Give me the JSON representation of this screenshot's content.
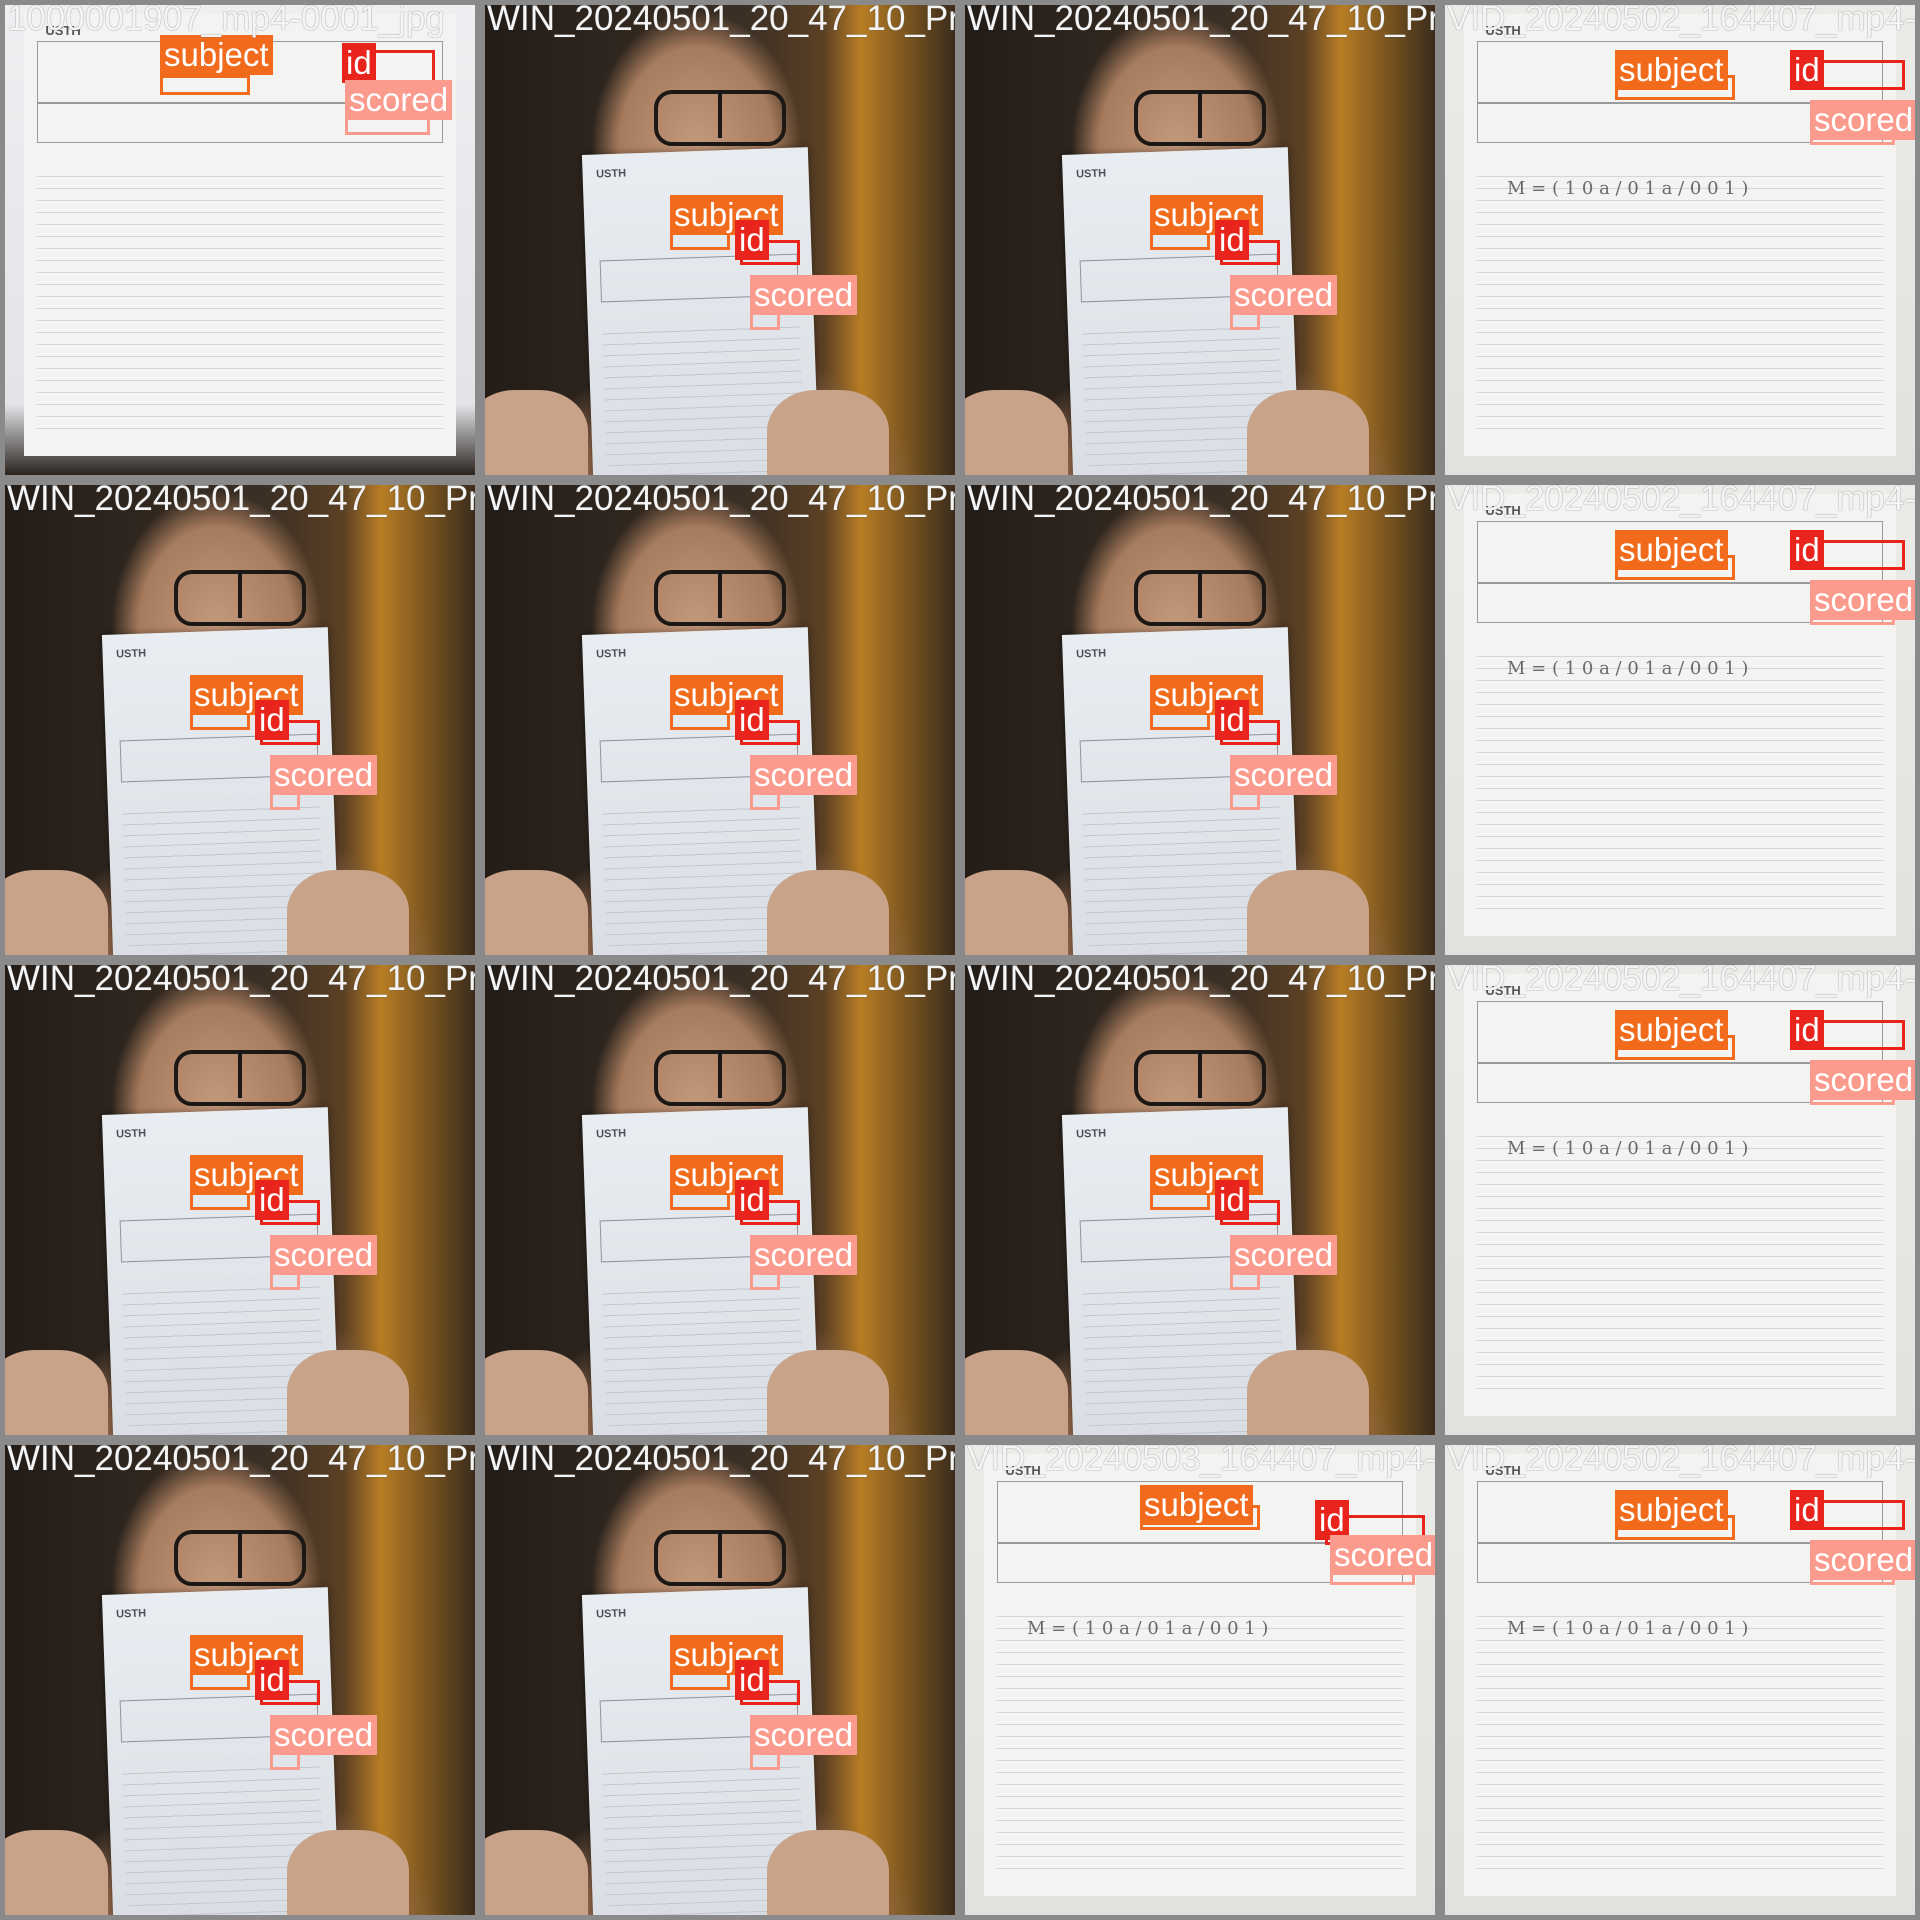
{
  "classes": {
    "subject": {
      "label": "subject",
      "color": "#f26b1d"
    },
    "id": {
      "label": "id",
      "color": "#e8241c"
    },
    "scored": {
      "label": "scored",
      "color": "#fa9b8e"
    }
  },
  "paper_header": "USTH",
  "formula_text": "M = ( 1 0 a / 0 1 a / 0 0 1 )",
  "tiles": [
    {
      "filename": "1000001907_mp4-0001_jpg",
      "kind": "top"
    },
    {
      "filename": "WIN_20240501_20_47_10_Pro_mp4-0103_jpg",
      "kind": "webcam"
    },
    {
      "filename": "WIN_20240501_20_47_10_Pro_mp4-0061_jpg",
      "kind": "webcam"
    },
    {
      "filename": "VID_20240502_164407_mp4-0002_jpg",
      "kind": "scan"
    },
    {
      "filename": "WIN_20240501_20_47_10_Pro_mp4-0091_jpg",
      "kind": "webcam"
    },
    {
      "filename": "WIN_20240501_20_47_10_Pro_mp4-0091_jpg",
      "kind": "webcam"
    },
    {
      "filename": "WIN_20240501_20_47_10_Pro_mp4-0051_jpg",
      "kind": "webcam"
    },
    {
      "filename": "VID_20240502_164407_mp4-0002_jpg",
      "kind": "scan"
    },
    {
      "filename": "WIN_20240501_20_47_10_Pro_mp4-0081_jpg",
      "kind": "webcam"
    },
    {
      "filename": "WIN_20240501_20_47_10_Pro_mp4-0081_jpg",
      "kind": "webcam"
    },
    {
      "filename": "WIN_20240501_20_47_10_Pro_mp4-0041_jpg",
      "kind": "webcam"
    },
    {
      "filename": "VID_20240502_164407_mp4-0002_jpg",
      "kind": "scan"
    },
    {
      "filename": "WIN_20240501_20_47_10_Pro_mp4-0071_jpg",
      "kind": "webcam"
    },
    {
      "filename": "WIN_20240501_20_47_10_Pro_mp4-0071_jpg",
      "kind": "webcam"
    },
    {
      "filename": "VID_20240503_164407_mp4-0003_jpg",
      "kind": "scan"
    },
    {
      "filename": "VID_20240502_164407_mp4-0002_jpg",
      "kind": "scan"
    }
  ]
}
